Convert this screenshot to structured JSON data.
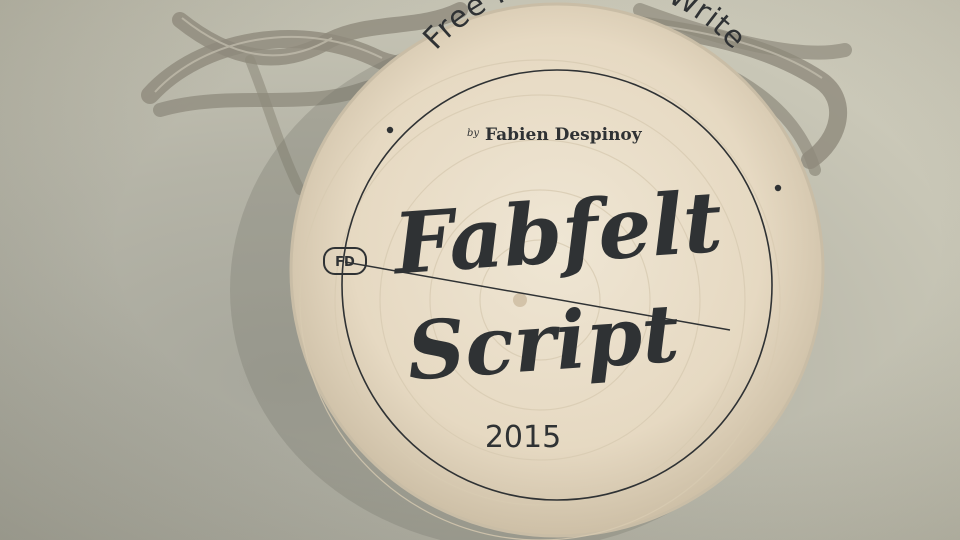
{
  "badge": {
    "arc_text": "Free Font Hand Write",
    "byline_prefix": "by",
    "author": "Fabien Despinoy",
    "title_line1": "Fabfelt",
    "title_line2": "Script",
    "year": "2015",
    "monogram": "FD"
  },
  "colors": {
    "ink": "#2f3234",
    "wood": "#e8dcc8",
    "twine": "#8e8a7c",
    "background": "#bcbaa9"
  }
}
